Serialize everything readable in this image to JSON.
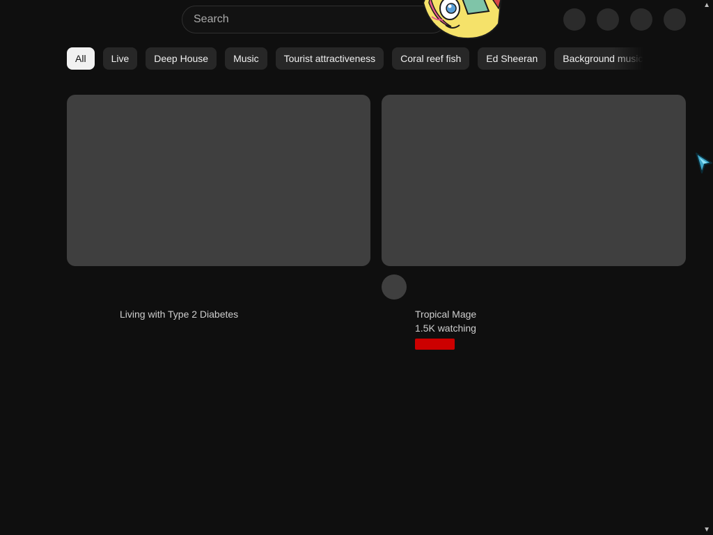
{
  "search": {
    "placeholder": "Search"
  },
  "chips": [
    "All",
    "Live",
    "Deep House",
    "Music",
    "Tourist attractiveness",
    "Coral reef fish",
    "Ed Sheeran",
    "Background music"
  ],
  "active_chip": "All",
  "videos": [
    {
      "title": "Living with Type 2 Diabetes"
    },
    {
      "channel": "Tropical Mage",
      "meta": "1.5K watching",
      "live": true
    }
  ],
  "colors": {
    "background": "#0f0f0f",
    "chip": "#272727",
    "chip_active": "#f1f1f1",
    "placeholder": "#3f3f3f",
    "live": "#cc0000"
  },
  "icons": {
    "scroll_up": "▲",
    "scroll_down": "▼"
  }
}
